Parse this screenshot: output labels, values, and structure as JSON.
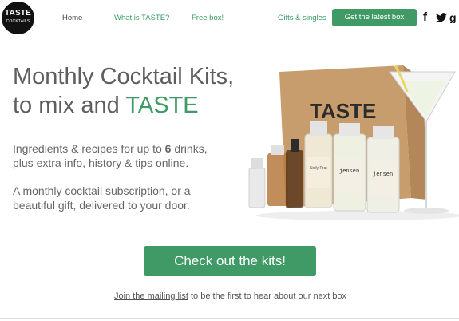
{
  "logo": {
    "line1": "TASTE",
    "line2": "COCKTAILS"
  },
  "nav": {
    "home": "Home",
    "what": "What is TASTE?",
    "free": "Free box!",
    "gifts": "Gifts & singles",
    "latest_button": "Get the latest box"
  },
  "social": {
    "facebook": "f",
    "twitter": "𝕥",
    "other": "ꞡ"
  },
  "hero": {
    "line1": "Monthly Cocktail Kits,",
    "line2_prefix": "to mix and ",
    "line2_accent": "TASTE",
    "para1_a": "Ingredients & recipes for up to ",
    "para1_num": "6",
    "para1_b": " drinks,",
    "para1_c": "plus extra info, history & tips online.",
    "para2_a": "A monthly cocktail subscription, or a",
    "para2_b": "beautiful gift, delivered to your door."
  },
  "product": {
    "bag_text": "TASTE",
    "bottle_labels": [
      "Nolly Prat",
      "jensen",
      "jensen"
    ]
  },
  "cta": {
    "label": "Check out the kits!"
  },
  "mailing": {
    "link": "Join the mailing list",
    "rest": " to be the first to hear about our next box"
  },
  "colors": {
    "accent": "#3f9a66",
    "text": "#5e5e5e"
  }
}
